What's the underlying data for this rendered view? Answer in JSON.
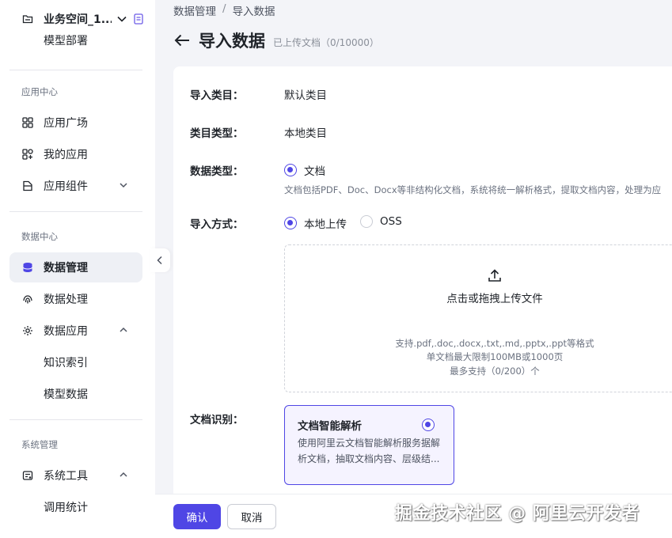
{
  "sidebar": {
    "workspace_name": "业务空间_1...",
    "partial_item": "模型部署",
    "app_center_label": "应用中心",
    "app_items": [
      {
        "label": "应用广场",
        "icon": "grid-icon"
      },
      {
        "label": "我的应用",
        "icon": "apps-icon"
      },
      {
        "label": "应用组件",
        "icon": "component-icon"
      }
    ],
    "data_center_label": "数据中心",
    "data_items": [
      {
        "label": "数据管理",
        "icon": "database-icon",
        "active": true
      },
      {
        "label": "数据处理",
        "icon": "fingerprint-icon"
      },
      {
        "label": "数据应用",
        "icon": "gear-icon"
      }
    ],
    "data_app_sub": [
      "知识索引",
      "模型数据"
    ],
    "system_label": "系统管理",
    "system_items": [
      {
        "label": "系统工具",
        "icon": "tool-icon"
      }
    ],
    "system_sub": [
      "调用统计"
    ]
  },
  "breadcrumb": {
    "parent": "数据管理",
    "separator": "/",
    "current": "导入数据"
  },
  "header": {
    "title": "导入数据",
    "subtitle": "已上传文档（0/10000）"
  },
  "form": {
    "category_label": "导入类目：",
    "category_value": "默认类目",
    "category_type_label": "类目类型：",
    "category_type_value": "本地类目",
    "data_type_label": "数据类型：",
    "data_type_option": "文档",
    "data_type_hint": "文档包括PDF、Doc、Docx等非结构化文档，系统将统一解析格式，提取文档内容，处理为应",
    "import_method_label": "导入方式：",
    "import_methods": [
      "本地上传",
      "OSS"
    ],
    "upload": {
      "title": "点击或拖拽上传文件",
      "line1": "支持.pdf,.doc,.docx,.txt,.md,.pptx,.ppt等格式",
      "line2": "单文档最大限制100MB或1000页",
      "line3": "最多支持（0/200）个"
    },
    "doc_recognition_label": "文档识别：",
    "recognition_option": {
      "title": "文档智能解析",
      "desc": "使用阿里云文档智能解析服务据解析文档，抽取文档内容、层级结..."
    }
  },
  "footer": {
    "confirm": "确认",
    "cancel": "取消"
  },
  "watermark": "掘金技术社区 @ 阿里云开发者",
  "colors": {
    "accent": "#4f46e5",
    "background": "#f3f4f8"
  }
}
